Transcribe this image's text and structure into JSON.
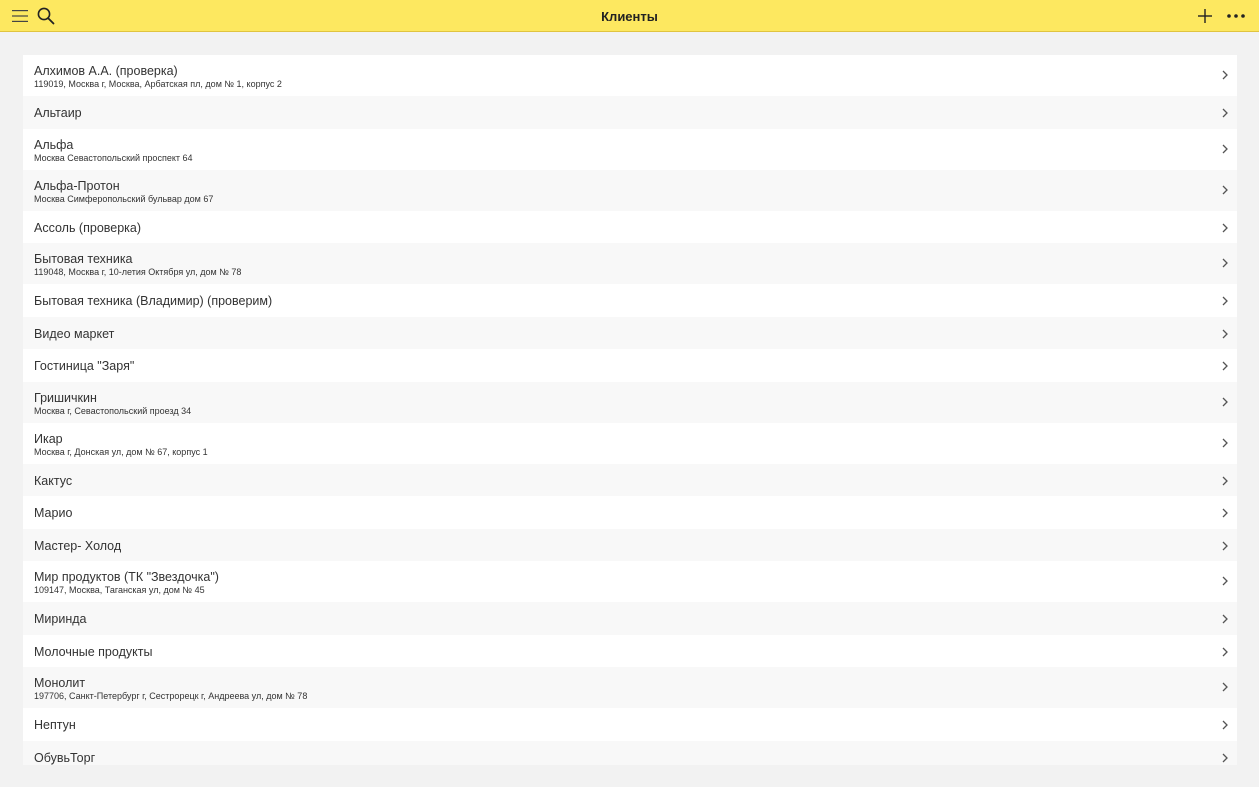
{
  "header": {
    "title": "Клиенты"
  },
  "icons": {
    "menu": "hamburger-icon",
    "search": "search-icon",
    "add": "plus-icon",
    "more": "ellipsis-icon",
    "row": "chevron-right-icon"
  },
  "colors": {
    "header_background": "#fde860",
    "page_background": "#f2f2f2"
  },
  "clients": [
    {
      "name": "Алхимов А.А. (проверка)",
      "address": "119019, Москва г, Москва, Арбатская пл, дом № 1, корпус 2"
    },
    {
      "name": "Альтаир",
      "address": ""
    },
    {
      "name": "Альфа",
      "address": "Москва Севастопольский проспект 64"
    },
    {
      "name": "Альфа-Протон",
      "address": "Москва Симферопольский бульвар дом 67"
    },
    {
      "name": "Ассоль (проверка)",
      "address": ""
    },
    {
      "name": "Бытовая техника",
      "address": "119048, Москва г, 10-летия Октября ул, дом № 78"
    },
    {
      "name": "Бытовая техника (Владимир) (проверим)",
      "address": ""
    },
    {
      "name": "Видео маркет",
      "address": ""
    },
    {
      "name": "Гостиница \"Заря\"",
      "address": ""
    },
    {
      "name": "Гришичкин",
      "address": "Москва г, Севастопольский проезд 34"
    },
    {
      "name": "Икар",
      "address": "Москва г, Донская ул, дом № 67, корпус 1"
    },
    {
      "name": "Кактус",
      "address": ""
    },
    {
      "name": "Марио",
      "address": ""
    },
    {
      "name": "Мастер- Холод",
      "address": ""
    },
    {
      "name": "Мир продуктов (ТК \"Звездочка\")",
      "address": "109147, Москва, Таганская ул, дом № 45"
    },
    {
      "name": "Миринда",
      "address": ""
    },
    {
      "name": "Молочные продукты",
      "address": ""
    },
    {
      "name": "Монолит",
      "address": "197706, Санкт-Петербург г, Сестрорецк г, Андреева ул, дом № 78"
    },
    {
      "name": "Нептун",
      "address": ""
    },
    {
      "name": "ОбувьТорг",
      "address": ""
    }
  ]
}
